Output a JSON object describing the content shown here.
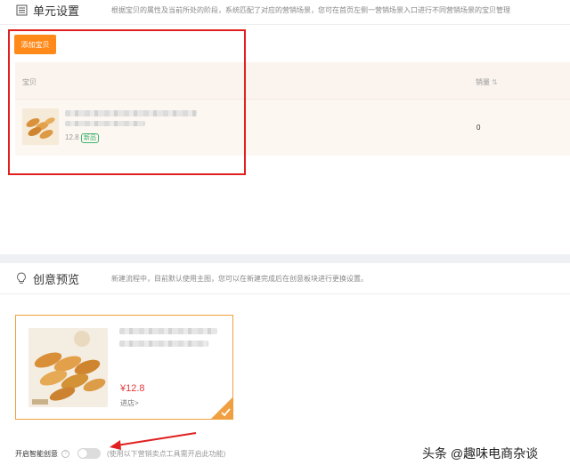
{
  "unit_settings": {
    "title": "单元设置",
    "description": "根据宝贝的属性及当前所处的阶段，系统匹配了对应的营销场景，您可在首页左侧一营销场景入口进行不同营销场景的宝贝管理",
    "icon": "list-icon",
    "add_button": "添加宝贝",
    "table": {
      "col_item": "宝贝",
      "col_sales": "销量",
      "rows": [
        {
          "price": "12.8",
          "badge": "新品",
          "sales": "0"
        }
      ]
    }
  },
  "creative_preview": {
    "title": "创意预览",
    "description": "新建流程中，目前默认使用主图，您可以在新建完成后在创意板块进行更换设置。",
    "icon": "lightbulb-icon",
    "card": {
      "price": "¥12.8",
      "shop_link": "进店>"
    }
  },
  "smart_creative": {
    "label": "开启智能创意",
    "help": "?",
    "enabled": false,
    "hint": "(使用以下营销卖点工具需开启此功能)"
  },
  "watermark": "头条 @趣味电商杂谈",
  "colors": {
    "accent_orange": "#ff8a1a",
    "annotation_red": "#e02020",
    "price_red": "#e4393c",
    "badge_green": "#3bb36f"
  }
}
